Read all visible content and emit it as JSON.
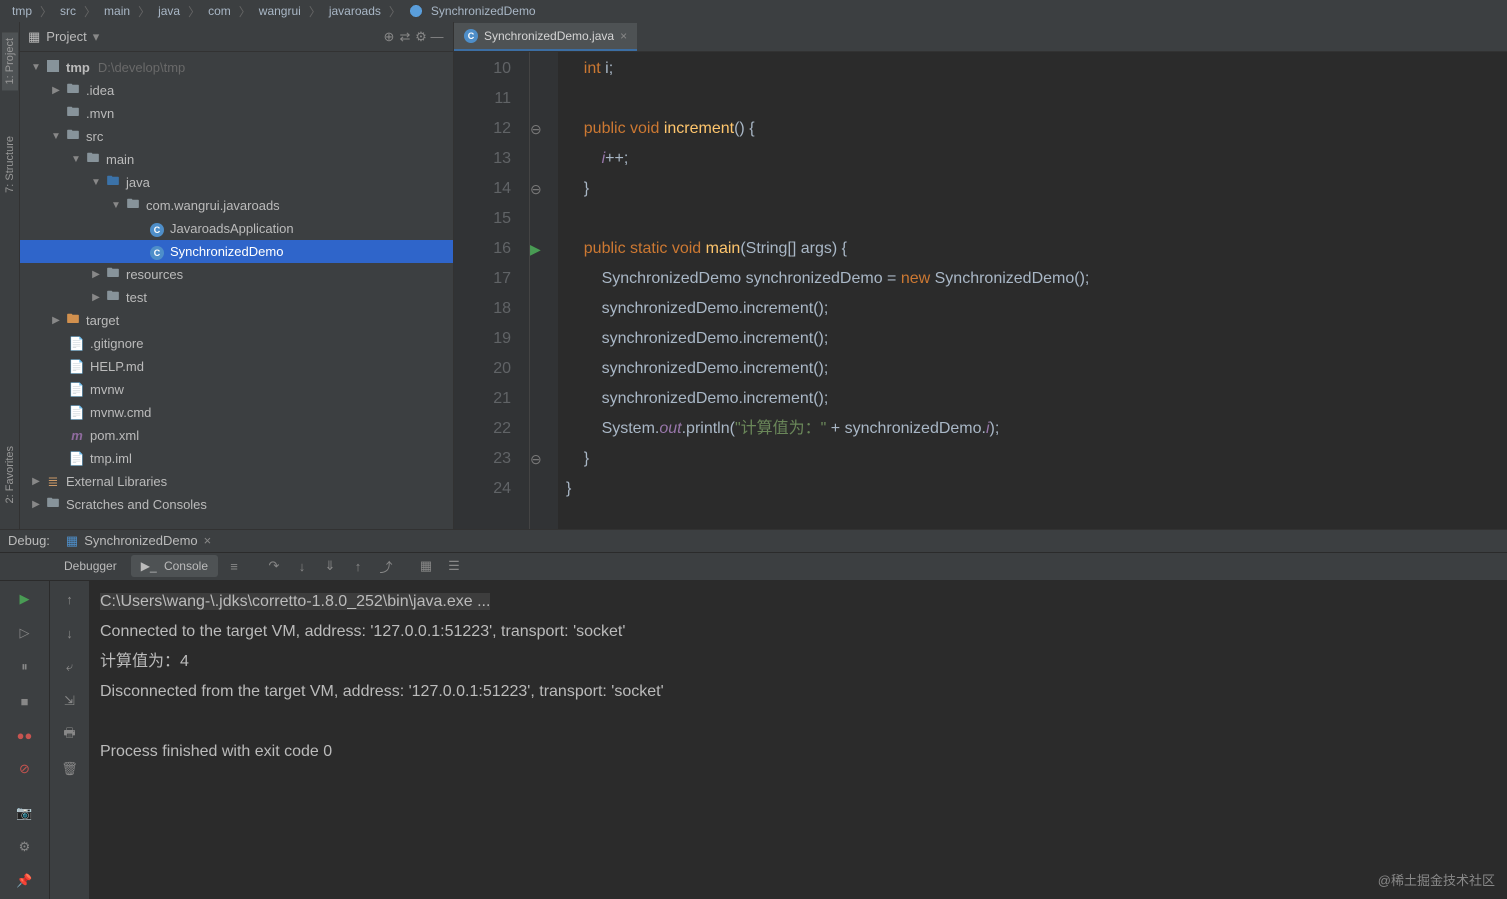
{
  "breadcrumb": [
    "tmp",
    "src",
    "main",
    "java",
    "com",
    "wangrui",
    "javaroads"
  ],
  "breadcrumb_class": "SynchronizedDemo",
  "project": {
    "title": "Project",
    "root_name": "tmp",
    "root_path": "D:\\develop\\tmp",
    "nodes": {
      "idea": ".idea",
      "mvn": ".mvn",
      "src": "src",
      "main": "main",
      "java": "java",
      "package": "com.wangrui.javaroads",
      "app_class": "JavaroadsApplication",
      "demo_class": "SynchronizedDemo",
      "resources": "resources",
      "test": "test",
      "target": "target",
      "gitignore": ".gitignore",
      "help": "HELP.md",
      "mvnw": "mvnw",
      "mvnw_cmd": "mvnw.cmd",
      "pom": "pom.xml",
      "tmp_iml": "tmp.iml",
      "ext_lib": "External Libraries",
      "scratches": "Scratches and Consoles"
    }
  },
  "sidebar_tabs": {
    "project_tab": "1: Project",
    "structure_tab": "7: Structure",
    "favorites_tab": "2: Favorites"
  },
  "editor": {
    "tab_name": "SynchronizedDemo.java",
    "line_start": 10,
    "lines": [
      {
        "n": 10,
        "html": "    <span class='kw'>int</span> i;"
      },
      {
        "n": 11,
        "html": ""
      },
      {
        "n": 12,
        "html": "    <span class='kw'>public void</span> <span class='mth'>increment</span>() {"
      },
      {
        "n": 13,
        "html": "        <span class='fld'>i</span>++;"
      },
      {
        "n": 14,
        "html": "    }"
      },
      {
        "n": 15,
        "html": "    "
      },
      {
        "n": 16,
        "html": "    <span class='kw'>public static void</span> <span class='mth'>main</span>(String[] args) {"
      },
      {
        "n": 17,
        "html": "        SynchronizedDemo synchronizedDemo = <span class='kw'>new</span> SynchronizedDemo();"
      },
      {
        "n": 18,
        "html": "        synchronizedDemo.increment();"
      },
      {
        "n": 19,
        "html": "        synchronizedDemo.increment();"
      },
      {
        "n": 20,
        "html": "        synchronizedDemo.increment();"
      },
      {
        "n": 21,
        "html": "        synchronizedDemo.increment();"
      },
      {
        "n": 22,
        "html": "        System.<span class='fld'>out</span>.println(<span class='str'>\"计算值为：\"</span> + synchronizedDemo.<span class='fld'>i</span>);"
      },
      {
        "n": 23,
        "html": "    }"
      },
      {
        "n": 24,
        "html": "}"
      }
    ],
    "run_line": 16,
    "fold_lines": [
      12,
      14,
      16,
      23
    ]
  },
  "debug": {
    "label": "Debug:",
    "tab_name": "SynchronizedDemo",
    "debugger_btn": "Debugger",
    "console_btn": "Console",
    "output": [
      "C:\\Users\\wang-\\.jdks\\corretto-1.8.0_252\\bin\\java.exe ...",
      "Connected to the target VM, address: '127.0.0.1:51223', transport: 'socket'",
      "计算值为：4",
      "Disconnected from the target VM, address: '127.0.0.1:51223', transport: 'socket'",
      "",
      "Process finished with exit code 0"
    ]
  },
  "watermark": "@稀土掘金技术社区"
}
